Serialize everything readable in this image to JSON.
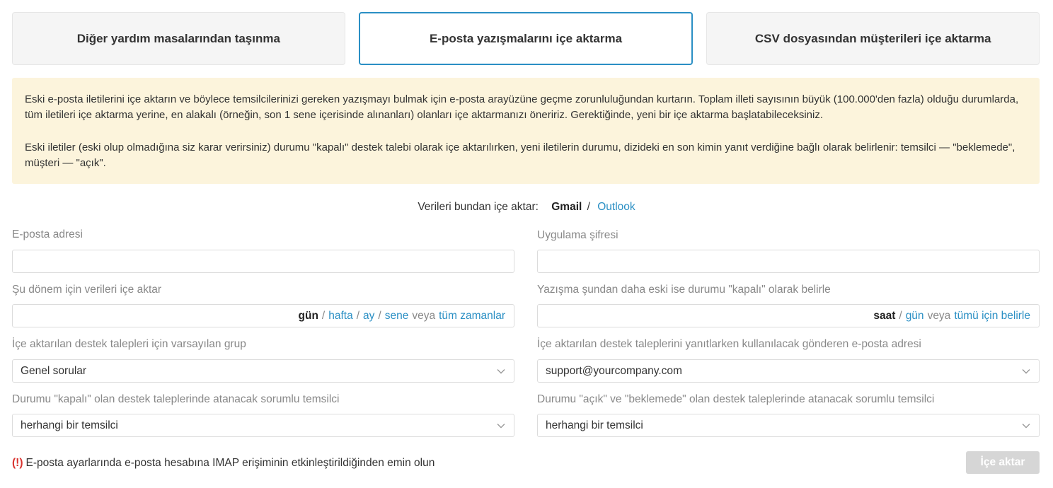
{
  "tabs": [
    {
      "label": "Diğer yardım masalarından taşınma",
      "active": false
    },
    {
      "label": "E-posta yazışmalarını içe aktarma",
      "active": true
    },
    {
      "label": "CSV dosyasından müşterileri içe aktarma",
      "active": false
    }
  ],
  "notice": {
    "paragraph1": "Eski e-posta iletilerini içe aktarın ve böylece temsilcilerinizi gereken yazışmayı bulmak için e-posta arayüzüne geçme zorunluluğundan kurtarın. Toplam illeti sayısının büyük (100.000'den fazla) olduğu durumlarda, tüm iletileri içe aktarma yerine, en alakalı (örneğin, son 1 sene içerisinde alınanları) olanları içe aktarmanızı öneririz. Gerektiğinde, yeni bir içe aktarma başlatabileceksiniz.",
    "paragraph2": "Eski iletiler (eski olup olmadığına siz karar verirsiniz) durumu \"kapalı\" destek talebi olarak içe aktarılırken, yeni iletilerin durumu, dizideki en son kimin yanıt verdiğine bağlı olarak belirlenir: temsilci — \"beklemede\", müşteri — \"açık\".",
    "background_color": "#fcf4dc"
  },
  "source": {
    "label": "Verileri bundan içe aktar:",
    "active": "Gmail",
    "separator": "/",
    "other": "Outlook"
  },
  "fields": {
    "email": {
      "label": "E-posta adresi",
      "value": ""
    },
    "app_password": {
      "label": "Uygulama şifresi",
      "value": ""
    },
    "import_period": {
      "label": "Şu dönem için verileri içe aktar",
      "value": "",
      "units": {
        "active": "gün",
        "week": "hafta",
        "month": "ay",
        "year": "sene",
        "or": "veya",
        "all": "tüm zamanlar",
        "sep": "/"
      }
    },
    "closed_threshold": {
      "label": "Yazışma şundan daha eski ise durumu \"kapalı\" olarak belirle",
      "value": "",
      "units": {
        "active": "saat",
        "day": "gün",
        "or": "veya",
        "all": "tümü için belirle",
        "sep": "/"
      }
    },
    "default_group": {
      "label": "İçe aktarılan destek talepleri için varsayılan grup",
      "value": "Genel sorular"
    },
    "sender_email": {
      "label": "İçe aktarılan destek taleplerini yanıtlarken kullanılacak gönderen e-posta adresi",
      "value": "support@yourcompany.com"
    },
    "closed_agent": {
      "label": "Durumu \"kapalı\" olan destek taleplerinde atanacak sorumlu temsilci",
      "value": "herhangi bir temsilci"
    },
    "open_agent": {
      "label": "Durumu \"açık\" ve \"beklemede\" olan destek taleplerinde atanacak sorumlu temsilci",
      "value": "herhangi bir temsilci"
    }
  },
  "warning": {
    "mark": "(!)",
    "text": "E-posta ayarlarında e-posta hesabına IMAP erişiminin etkinleştirildiğinden emin olun"
  },
  "import_button": {
    "label": "İçe aktar",
    "enabled": false
  },
  "colors": {
    "accent": "#2a8fc4",
    "warning": "#d9322e",
    "disabled_button": "#d6d6d6"
  },
  "icons": {
    "select_arrow": "chevron-down-icon"
  }
}
